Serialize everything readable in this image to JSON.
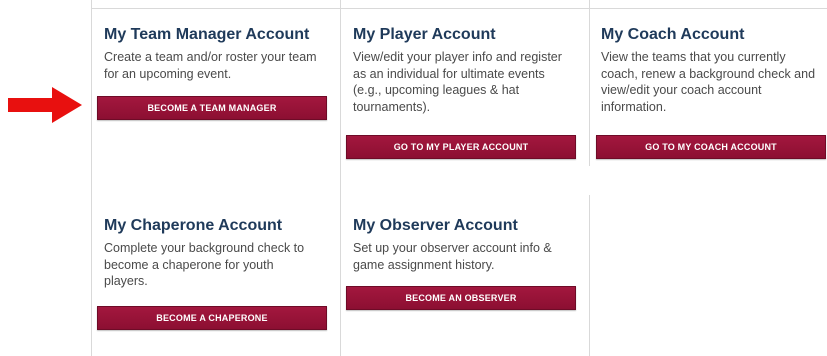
{
  "cards": [
    {
      "title": "My Team Manager Account",
      "description": "Create a team and/or roster your team for an upcoming event.",
      "button": "BECOME A TEAM MANAGER"
    },
    {
      "title": "My Player Account",
      "description": "View/edit your player info and register as an individual for ultimate events (e.g., upcoming leagues & hat tournaments).",
      "button": "GO TO MY PLAYER ACCOUNT"
    },
    {
      "title": "My Coach Account",
      "description": "View the teams that you currently coach, renew a background check and view/edit your coach account information.",
      "button": "GO TO MY COACH ACCOUNT"
    },
    {
      "title": "My Chaperone Account",
      "description": "Complete your background check to become a chaperone for youth players.",
      "button": "BECOME A CHAPERONE"
    },
    {
      "title": "My Observer Account",
      "description": "Set up your observer account info & game assignment history.",
      "button": "BECOME AN OBSERVER"
    }
  ],
  "annotation": {
    "arrow_color": "#e8100f",
    "points_to": "become-team-manager-button"
  },
  "colors": {
    "title": "#1f3a5a",
    "button": "#9a1439",
    "text": "#4a4a4a"
  }
}
